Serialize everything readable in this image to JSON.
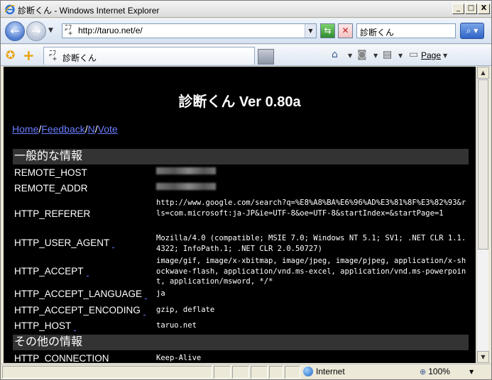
{
  "window": {
    "title": "診断くん - Windows Internet Explorer",
    "minimize": "_",
    "maximize": "□",
    "close": "X"
  },
  "address": {
    "url": "http://taruo.net/e/",
    "search_text": "診断くん"
  },
  "tab": {
    "label": "診断くん"
  },
  "command": {
    "page_label": "Page"
  },
  "content": {
    "title": "診断くん Ver 0.80a",
    "links": [
      {
        "label": "Home"
      },
      {
        "label": "Feedback"
      },
      {
        "label": "N"
      },
      {
        "label": "Vote"
      }
    ],
    "separator": "/",
    "section1": "一般的な情報",
    "section2": "その他の情報",
    "rows": [
      {
        "key": "REMOTE_HOST",
        "value": ""
      },
      {
        "key": "REMOTE_ADDR",
        "value": ""
      },
      {
        "key": "HTTP_REFERER",
        "value": "http://www.google.com/search?q=%E8%A8%BA%E6%96%AD%E3%81%8F%E3%82%93&rls=com.microsoft:ja-JP&ie=UTF-8&oe=UTF-8&startIndex=&startPage=1"
      },
      {
        "key": "HTTP_USER_AGENT",
        "value": "Mozilla/4.0 (compatible; MSIE 7.0; Windows NT 5.1; SV1; .NET CLR 1.1.4322; InfoPath.1; .NET CLR 2.0.50727)"
      },
      {
        "key": "HTTP_ACCEPT",
        "value": "image/gif, image/x-xbitmap, image/jpeg, image/pjpeg, application/x-shockwave-flash, application/vnd.ms-excel, application/vnd.ms-powerpoint, application/msword, */*"
      },
      {
        "key": "HTTP_ACCEPT_LANGUAGE",
        "value": "ja"
      },
      {
        "key": "HTTP_ACCEPT_ENCODING",
        "value": "gzip, deflate"
      },
      {
        "key": "HTTP_HOST",
        "value": "taruo.net"
      },
      {
        "key": "HTTP_CONNECTION",
        "value": "Keep-Alive"
      }
    ]
  },
  "status": {
    "zone": "Internet",
    "zoom": "100%"
  },
  "icons": {
    "app": "ie-icon",
    "back": "back-arrow-icon",
    "forward": "forward-arrow-icon",
    "refresh": "refresh-icon",
    "stop": "stop-icon",
    "search": "search-icon",
    "favorites": "star-icon",
    "add_favorites": "plus-icon",
    "home": "home-icon",
    "feeds": "rss-icon",
    "print": "printer-icon",
    "zone": "globe-icon",
    "zoom": "magnifier-icon"
  },
  "colors": {
    "page_background": "#000000",
    "section_background": "#333333",
    "link": "#6a7cff"
  }
}
